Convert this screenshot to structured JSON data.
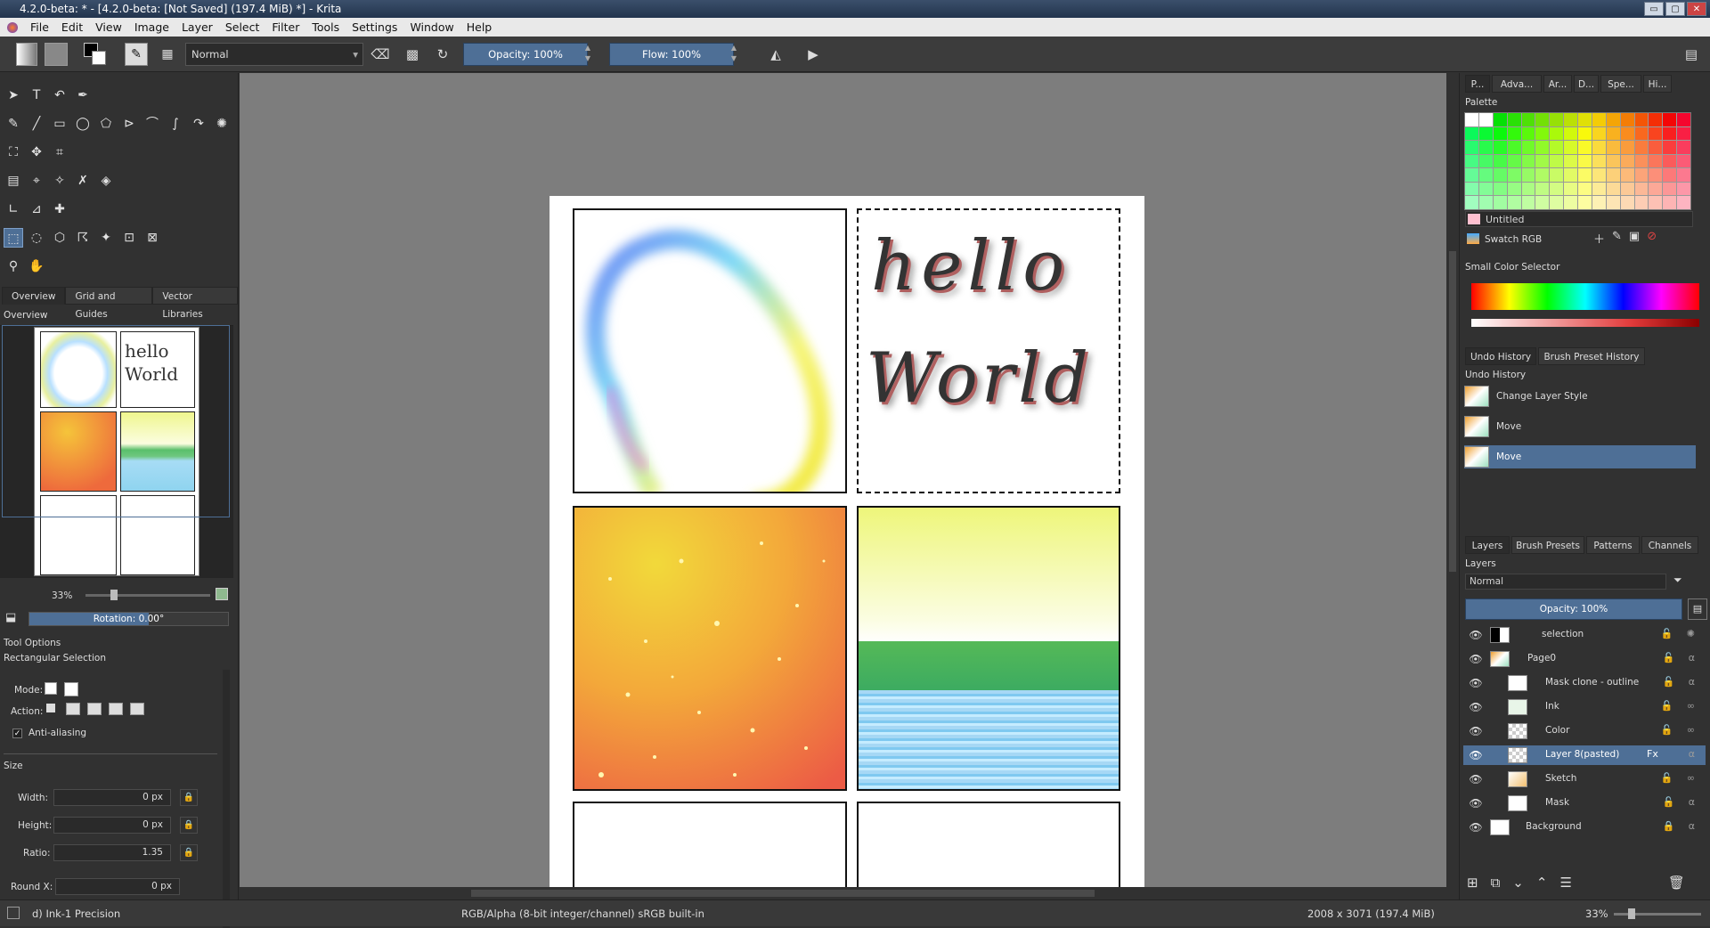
{
  "window": {
    "title": "4.2.0-beta: * - [4.2.0-beta:  [Not Saved]  (197.4 MiB) *] - Krita",
    "buttons": [
      "▭",
      "▢",
      "✕"
    ]
  },
  "menu": [
    "File",
    "Edit",
    "View",
    "Image",
    "Layer",
    "Select",
    "Filter",
    "Tools",
    "Settings",
    "Window",
    "Help"
  ],
  "toolbar": {
    "blend_mode": "Normal",
    "opacity_label": "Opacity:  100%",
    "flow_label": "Flow:  100%"
  },
  "left_dock": {
    "tabs": [
      "Overview",
      "Grid and Guides",
      "Vector Libraries"
    ],
    "overview_title": "Overview",
    "zoom": "33%",
    "rotation_label": "Rotation: 0.00°",
    "tool_options_title": "Tool Options",
    "tool_name": "Rectangular Selection",
    "mode_label": "Mode:",
    "action_label": "Action:",
    "anti_alias_label": "Anti-aliasing",
    "size_label": "Size",
    "width_label": "Width:",
    "width_value": "0 px",
    "height_label": "Height:",
    "height_value": "0 px",
    "ratio_label": "Ratio:",
    "ratio_value": "1.35",
    "roundx_label": "Round X:",
    "roundx_value": "0 px"
  },
  "canvas": {
    "hello_text": "hello",
    "world_text": "World"
  },
  "right_dock": {
    "top_tabs": [
      "P...",
      "Adva...",
      "Ar...",
      "D...",
      "Spe...",
      "Hi..."
    ],
    "palette_title": "Palette",
    "palette_name": "Untitled",
    "swatch_label": "Swatch RGB",
    "small_color_title": "Small Color Selector",
    "history_tabs": [
      "Undo History",
      "Brush Preset History"
    ],
    "undo_title": "Undo History",
    "undo_items": [
      "Change Layer Style",
      "Move",
      "Move"
    ],
    "layer_tabs": [
      "Layers",
      "Brush Presets",
      "Patterns",
      "Channels"
    ],
    "layers_title": "Layers",
    "layer_blend": "Normal",
    "layer_opacity": "Opacity:  100%",
    "layers": [
      "selection",
      "Page0",
      "Mask clone - outline",
      "Ink",
      "Color",
      "Layer 8(pasted)",
      "Sketch",
      "Mask",
      "Background"
    ],
    "fx_label": "Fx"
  },
  "status": {
    "brush": "d) Ink-1 Precision",
    "colorspace": "RGB/Alpha (8-bit integer/channel)  sRGB built-in",
    "dimensions": "2008 x 3071 (197.4 MiB)",
    "zoom": "33%"
  },
  "colors": {
    "accent": "#4e6f96"
  }
}
